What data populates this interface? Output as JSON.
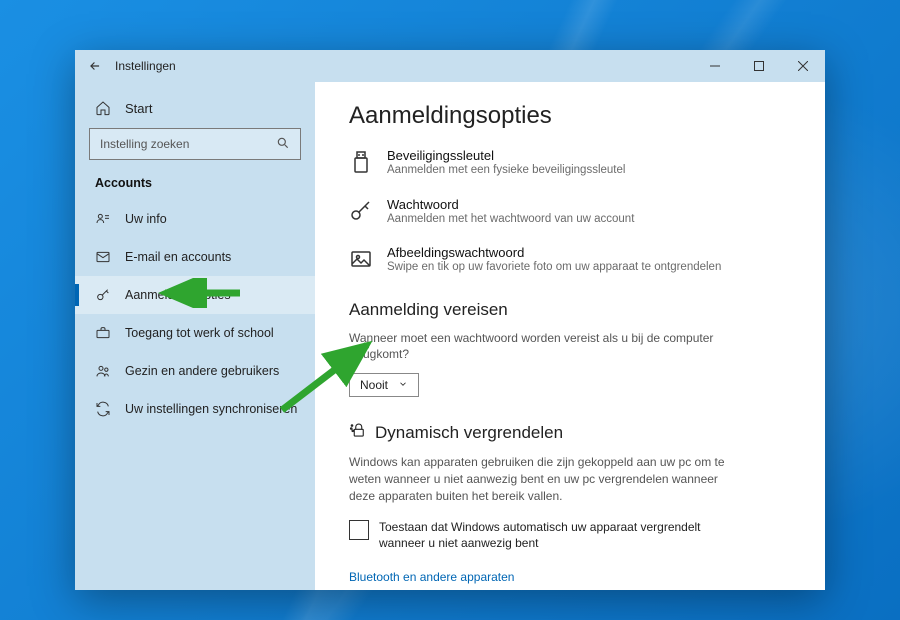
{
  "window": {
    "title": "Instellingen"
  },
  "sidebar": {
    "home_label": "Start",
    "search_placeholder": "Instelling zoeken",
    "section_header": "Accounts",
    "items": [
      {
        "label": "Uw info"
      },
      {
        "label": "E-mail en accounts"
      },
      {
        "label": "Aanmeldingsopties"
      },
      {
        "label": "Toegang tot werk of school"
      },
      {
        "label": "Gezin en andere gebruikers"
      },
      {
        "label": "Uw instellingen synchroniseren"
      }
    ]
  },
  "main": {
    "page_title": "Aanmeldingsopties",
    "options": [
      {
        "title": "Beveiligingssleutel",
        "desc": "Aanmelden met een fysieke beveiligingssleutel"
      },
      {
        "title": "Wachtwoord",
        "desc": "Aanmelden met het wachtwoord van uw account"
      },
      {
        "title": "Afbeeldingswachtwoord",
        "desc": "Swipe en tik op uw favoriete foto om uw apparaat te ontgrendelen"
      }
    ],
    "require_signin": {
      "heading": "Aanmelding vereisen",
      "question": "Wanneer moet een wachtwoord worden vereist als u bij de computer terugkomt?",
      "selected": "Nooit"
    },
    "dynamic_lock": {
      "heading": "Dynamisch vergrendelen",
      "desc": "Windows kan apparaten gebruiken die zijn gekoppeld aan uw pc om te weten wanneer u niet aanwezig bent en uw pc vergrendelen wanneer deze apparaten buiten het bereik vallen.",
      "checkbox_label": "Toestaan dat Windows automatisch uw apparaat vergrendelt wanneer u niet aanwezig bent",
      "link": "Bluetooth en andere apparaten"
    }
  }
}
